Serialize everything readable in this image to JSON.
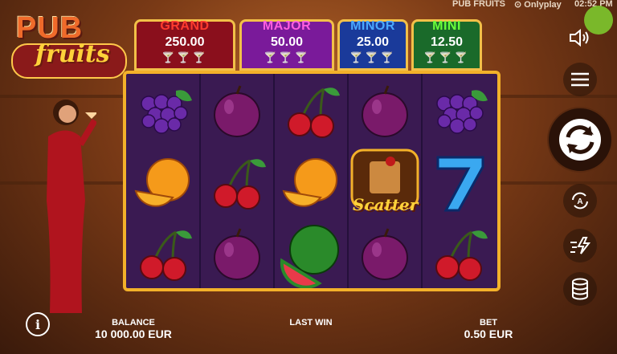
{
  "status": {
    "title": "PUB FRUITS",
    "provider": "Onlyplay",
    "time": "02:52 PM"
  },
  "logo": {
    "word1": "PUB",
    "word2": "fruits"
  },
  "jackpots": [
    {
      "label": "GRAND",
      "value": "250.00",
      "label_color": "#ff3b2f",
      "bg": "#8a0f1c"
    },
    {
      "label": "MAJOR",
      "value": "50.00",
      "label_color": "#ff5ee0",
      "bg": "#7a1a9a"
    },
    {
      "label": "MINOR",
      "value": "25.00",
      "label_color": "#4aa8ff",
      "bg": "#1a3a9a"
    },
    {
      "label": "MINI",
      "value": "12.50",
      "label_color": "#6aff3a",
      "bg": "#1a6a2a"
    }
  ],
  "reels": [
    [
      "grapes-icon",
      "orange-icon",
      "cherries-icon"
    ],
    [
      "plum-icon",
      "cherries-icon",
      "plum-icon"
    ],
    [
      "cherries-icon",
      "orange-icon",
      "watermelon-icon"
    ],
    [
      "plum-icon",
      "scatter-icon",
      "plum-icon"
    ],
    [
      "grapes-icon",
      "seven-icon",
      "cherries-icon"
    ]
  ],
  "scatter_label": "Scatter",
  "footer": {
    "balance_label": "BALANCE",
    "balance_value": "10 000.00 EUR",
    "last_win_label": "LAST WIN",
    "bet_label": "BET",
    "bet_value": "0.50 EUR"
  },
  "controls": [
    "sound-icon",
    "menu-icon",
    "spin-icon",
    "autoplay-icon",
    "turbo-icon",
    "bet-coins-icon",
    "info-icon"
  ]
}
